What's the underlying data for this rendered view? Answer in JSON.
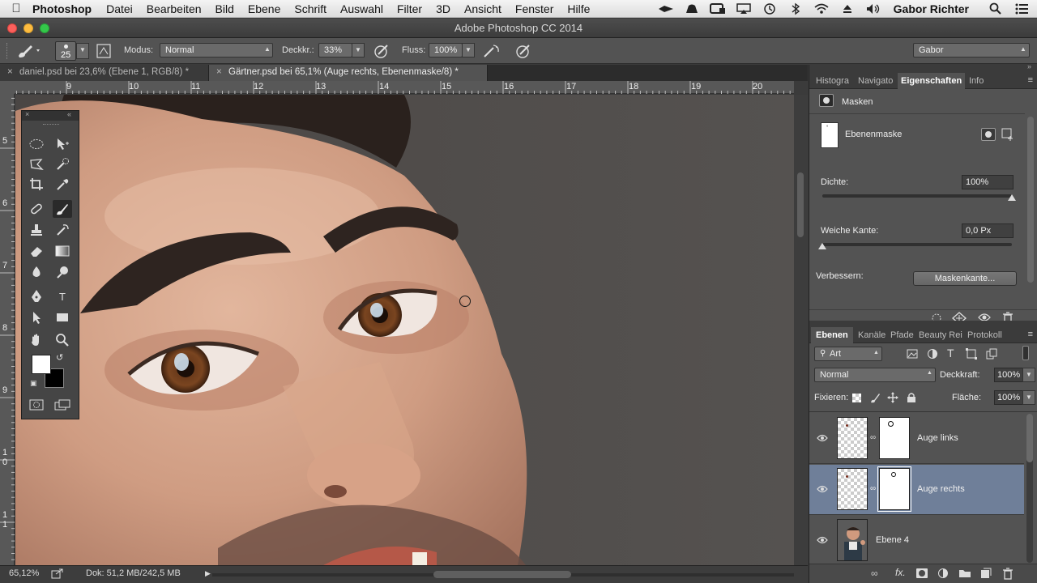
{
  "menubar": {
    "app": "Photoshop",
    "items": [
      "Datei",
      "Bearbeiten",
      "Bild",
      "Ebene",
      "Schrift",
      "Auswahl",
      "Filter",
      "3D",
      "Ansicht",
      "Fenster",
      "Hilfe"
    ],
    "user": "Gabor Richter"
  },
  "window": {
    "title": "Adobe Photoshop CC 2014"
  },
  "options": {
    "brush_size": "25",
    "mode_label": "Modus:",
    "mode_value": "Normal",
    "opacity_label": "Deckkr.:",
    "opacity_value": "33%",
    "flow_label": "Fluss:",
    "flow_value": "100%",
    "workspace": "Gabor"
  },
  "doc_tabs": [
    {
      "label": "daniel.psd bei 23,6% (Ebene 1, RGB/8) *"
    },
    {
      "label": "Gärtner.psd bei 65,1% (Auge rechts, Ebenenmaske/8) *"
    }
  ],
  "ruler": {
    "h_numbers": [
      "9",
      "10",
      "11",
      "12",
      "13",
      "14",
      "15",
      "16",
      "17",
      "18",
      "19",
      "20"
    ],
    "v_numbers": [
      "5",
      "6",
      "7",
      "8",
      "9",
      "1",
      "0",
      "1",
      "1"
    ]
  },
  "status": {
    "zoom": "65,12%",
    "doc": "Dok: 51,2 MB/242,5 MB"
  },
  "properties": {
    "tabs": [
      "Histogra",
      "Navigato",
      "Eigenschaften",
      "Info"
    ],
    "section": "Masken",
    "mask_label": "Ebenenmaske",
    "density_label": "Dichte:",
    "density_value": "100%",
    "density_level": 1.0,
    "feather_label": "Weiche Kante:",
    "feather_value": "0,0 Px",
    "feather_level": 0.0,
    "refine_label": "Verbessern:",
    "refine_button": "Maskenkante..."
  },
  "layers": {
    "tabs": [
      "Ebenen",
      "Kanäle",
      "Pfade",
      "Beauty Rei",
      "Protokoll"
    ],
    "filter_kind": "Art",
    "blend_mode": "Normal",
    "opacity_label": "Deckkraft:",
    "opacity_value": "100%",
    "lock_label": "Fixieren:",
    "fill_label": "Fläche:",
    "fill_value": "100%",
    "items": [
      {
        "name": "Auge links"
      },
      {
        "name": "Auge rechts"
      },
      {
        "name": "Ebene 4"
      }
    ]
  },
  "colors": {
    "selected_layer": "#6f7f99",
    "panel_bg": "#535353",
    "canvas_bg": "#4f4c4a"
  }
}
